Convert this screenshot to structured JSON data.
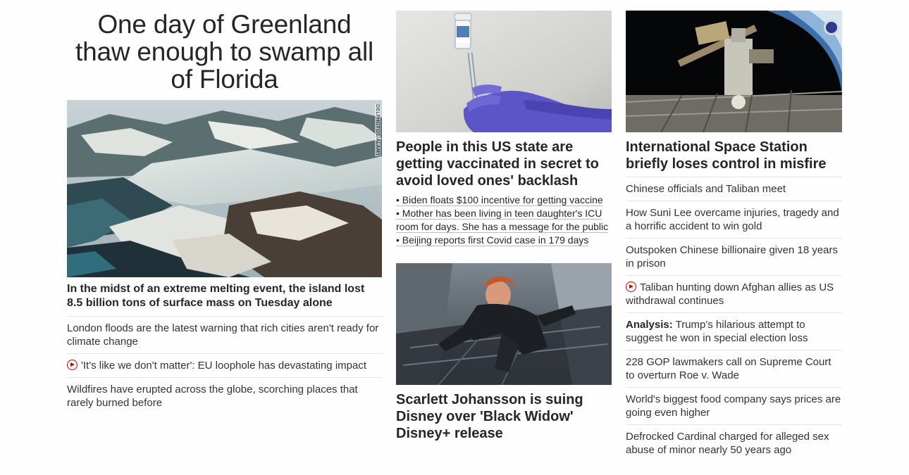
{
  "column1": {
    "headline": "One day of Greenland thaw enough to swamp all of Florida",
    "image_credit": "DELPHOTOS/ALAMY",
    "lead": "In the midst of an extreme melting event, the island lost 8.5 billion tons of surface mass on Tuesday alone",
    "stories": [
      {
        "text": "London floods are the latest warning that rich cities aren't ready for climate change",
        "video": false
      },
      {
        "text": "'It's like we don't matter': EU loophole has devastating impact",
        "video": true
      },
      {
        "text": "Wildfires have erupted across the globe, scorching places that rarely burned before",
        "video": false
      }
    ]
  },
  "column2": {
    "card1": {
      "headline": "People in this US state are getting vaccinated in secret to avoid loved ones' backlash",
      "bullets": [
        "• Biden floats $100 incentive for getting vaccine",
        "• Mother has been living in teen daughter's ICU room for days. She has a message for the public",
        "• Beijing reports first Covid case in 179 days"
      ]
    },
    "card2": {
      "headline": "Scarlett Johansson is suing Disney over 'Black Widow' Disney+ release"
    }
  },
  "column3": {
    "headline": "International Space Station briefly loses control in misfire",
    "stories": [
      {
        "prefix": "",
        "text": "Chinese officials and Taliban meet",
        "video": false
      },
      {
        "prefix": "",
        "text": "How Suni Lee overcame injuries, tragedy and a horrific accident to win gold",
        "video": false
      },
      {
        "prefix": "",
        "text": "Outspoken Chinese billionaire given 18 years in prison",
        "video": false
      },
      {
        "prefix": "",
        "text": "Taliban hunting down Afghan allies as US withdrawal continues",
        "video": true
      },
      {
        "prefix": "Analysis:",
        "text": "Trump's hilarious attempt to suggest he won in special election loss",
        "video": false
      },
      {
        "prefix": "",
        "text": "228 GOP lawmakers call on Supreme Court to overturn Roe v. Wade",
        "video": false
      },
      {
        "prefix": "",
        "text": "World's biggest food company says prices are going even higher",
        "video": false
      },
      {
        "prefix": "",
        "text": "Defrocked Cardinal charged for alleged sex abuse of minor nearly 50 years ago",
        "video": false
      }
    ]
  },
  "icons": {
    "video": "play-circle-icon",
    "agency_logo": "nasa-logo-icon"
  },
  "colors": {
    "accent": "#cc0000",
    "text": "#262626",
    "divider": "#e3e3e3"
  }
}
